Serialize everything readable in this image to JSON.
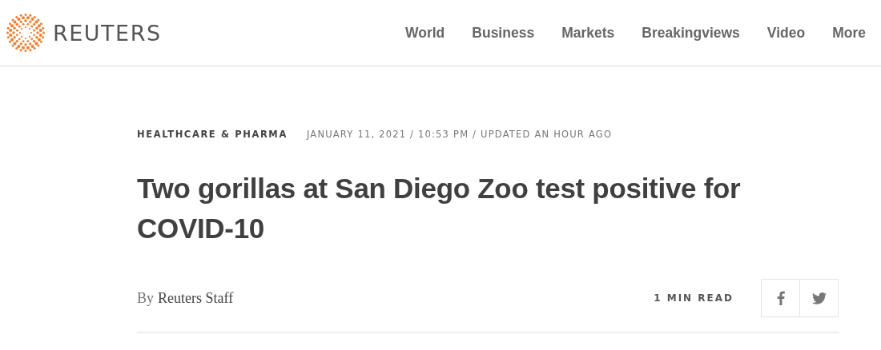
{
  "header": {
    "logo_text": "REUTERS",
    "nav": [
      {
        "label": "World"
      },
      {
        "label": "Business"
      },
      {
        "label": "Markets"
      },
      {
        "label": "Breakingviews"
      },
      {
        "label": "Video"
      },
      {
        "label": "More"
      }
    ]
  },
  "article": {
    "section": "HEALTHCARE & PHARMA",
    "dateline": "JANUARY 11, 2021 / 10:53 PM / UPDATED AN HOUR AGO",
    "headline": "Two gorillas at San Diego Zoo test positive for COVID-10",
    "byline_prefix": "By",
    "author": "Reuters Staff",
    "read_time": "1 MIN READ",
    "share": [
      {
        "kind": "facebook"
      },
      {
        "kind": "twitter"
      }
    ]
  }
}
